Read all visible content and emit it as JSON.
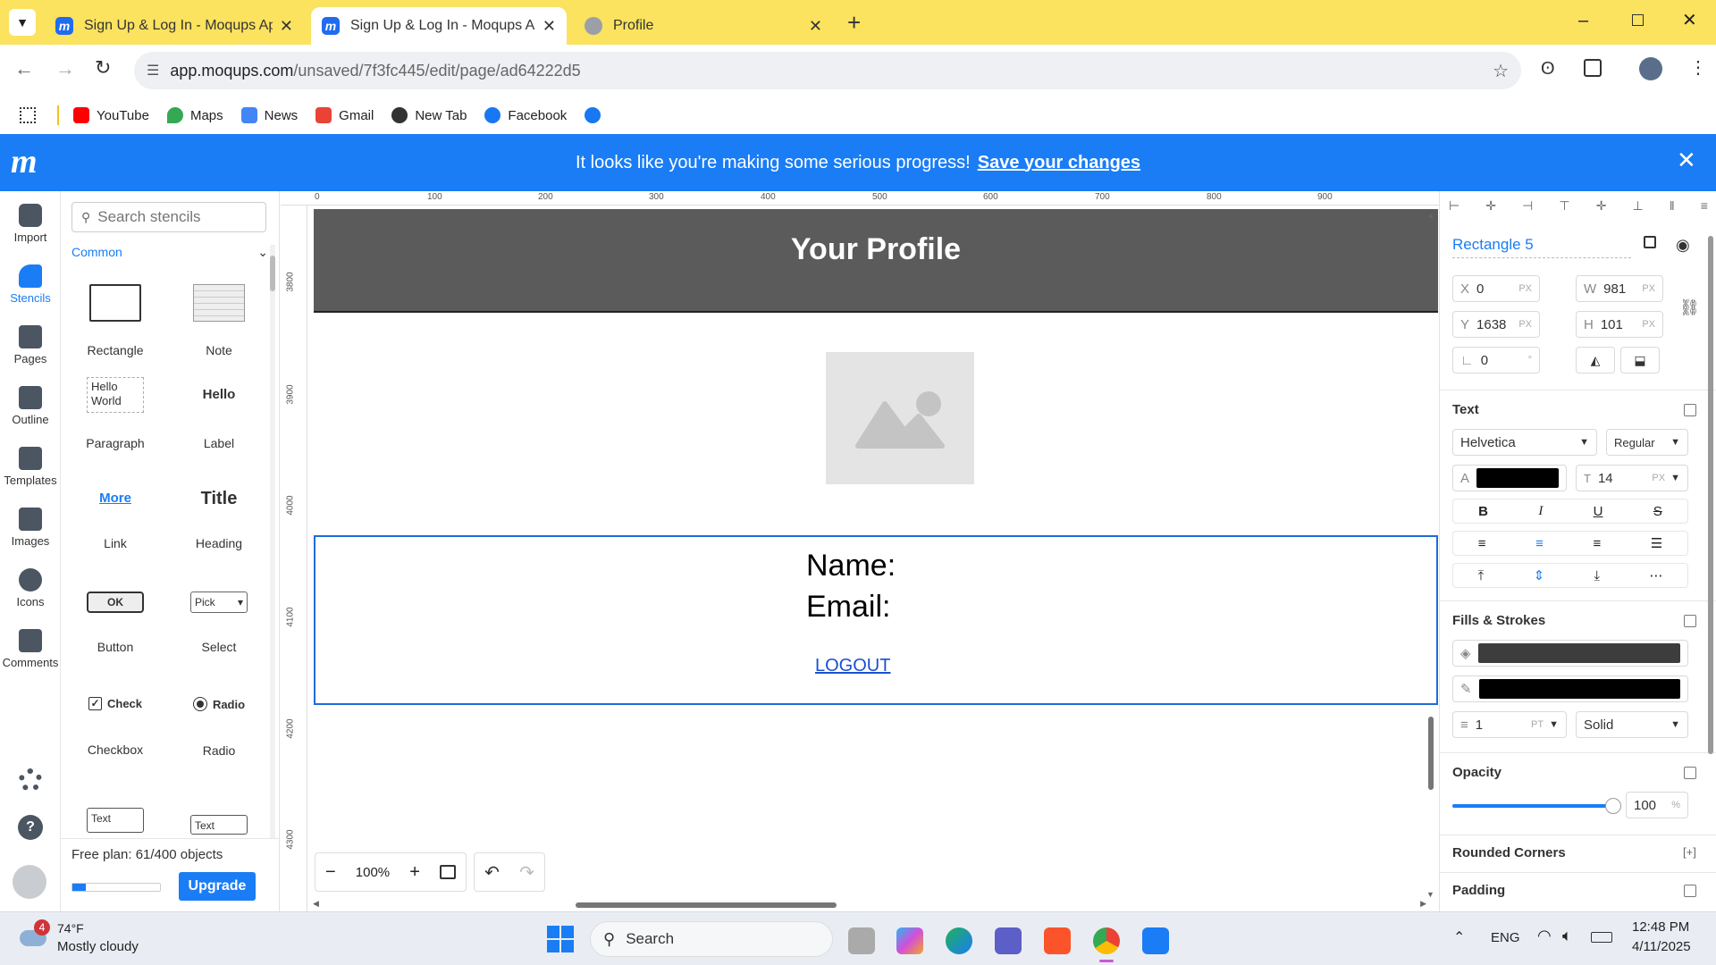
{
  "browser": {
    "tabs": [
      {
        "title": "Sign Up & Log In - Moqups App",
        "active": false
      },
      {
        "title": "Sign Up & Log In - Moqups App",
        "active": true
      },
      {
        "title": "Profile",
        "active": false
      }
    ],
    "url_domain": "app.moqups.com",
    "url_path": "/unsaved/7f3fc445/edit/page/ad64222d5",
    "bookmarks": [
      "YouTube",
      "Maps",
      "News",
      "Gmail",
      "New Tab",
      "Facebook"
    ]
  },
  "banner": {
    "message": "It looks like you're making some serious progress!",
    "link": "Save your changes"
  },
  "left_rail": {
    "items": [
      "Import",
      "Stencils",
      "Pages",
      "Outline",
      "Templates",
      "Images",
      "Icons",
      "Comments"
    ]
  },
  "stencils": {
    "search_placeholder": "Search stencils",
    "category": "Common",
    "items": [
      {
        "label": "Rectangle"
      },
      {
        "label": "Note"
      },
      {
        "label": "Paragraph",
        "preview": "Hello World"
      },
      {
        "label": "Label",
        "preview": "Hello"
      },
      {
        "label": "Link",
        "preview": "More"
      },
      {
        "label": "Heading",
        "preview": "Title"
      },
      {
        "label": "Button",
        "preview": "OK"
      },
      {
        "label": "Select",
        "preview": "Pick"
      },
      {
        "label": "Checkbox",
        "preview": "Check"
      },
      {
        "label": "Radio",
        "preview": "Radio"
      },
      {
        "label": "",
        "preview": "Text"
      },
      {
        "label": "",
        "preview": "Text"
      }
    ],
    "plan_text": "Free plan: 61/400 objects",
    "plan_progress": 0.15,
    "upgrade": "Upgrade"
  },
  "ruler": {
    "h_ticks": [
      "0",
      "100",
      "200",
      "300",
      "400",
      "500",
      "600",
      "700",
      "800",
      "900"
    ],
    "v_ticks": [
      "3800",
      "3900",
      "4000",
      "4100",
      "4200",
      "4300"
    ]
  },
  "canvas": {
    "header_title": "Your Profile",
    "name_label": "Name:",
    "email_label": "Email:",
    "logout": "LOGOUT",
    "zoom": "100%"
  },
  "properties": {
    "element_name": "Rectangle 5",
    "x": "0",
    "y": "1638",
    "w": "981",
    "h": "101",
    "angle": "0",
    "px": "PX",
    "deg": "°",
    "text_section": "Text",
    "font": "Helvetica",
    "weight": "Regular",
    "font_size": "14",
    "text_color": "#000000",
    "fills_section": "Fills & Strokes",
    "fill_color": "#3d3d3d",
    "stroke_color": "#000000",
    "stroke_width": "1",
    "stroke_unit": "PT",
    "stroke_style": "Solid",
    "opacity_section": "Opacity",
    "opacity": "100",
    "opacity_unit": "%",
    "rounded_section": "Rounded Corners",
    "padding_section": "Padding"
  },
  "taskbar": {
    "weather_temp": "74°F",
    "weather_desc": "Mostly cloudy",
    "weather_badge": "4",
    "search": "Search",
    "lang": "ENG",
    "time": "12:48 PM",
    "date": "4/11/2025"
  }
}
